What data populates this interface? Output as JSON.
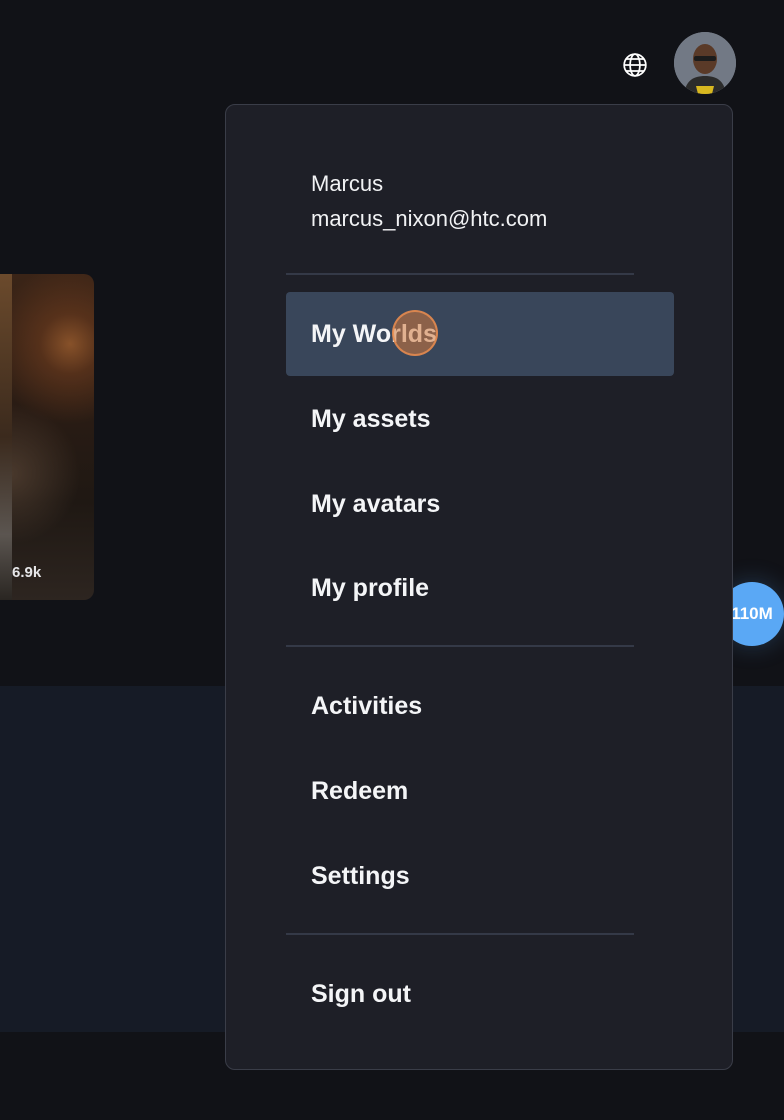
{
  "header": {
    "globe_icon": "globe-icon",
    "avatar_icon": "user-avatar"
  },
  "background": {
    "world_card": {
      "visits": "6.9k"
    },
    "badge_count": "110M",
    "badge_color": "#5aa8f5"
  },
  "menu": {
    "user": {
      "name": "Marcus",
      "email": "marcus_nixon@htc.com"
    },
    "items": [
      {
        "label": "My Worlds",
        "active": true
      },
      {
        "label": "My assets"
      },
      {
        "label": "My avatars"
      },
      {
        "label": "My profile"
      },
      {
        "label": "Activities"
      },
      {
        "label": "Redeem"
      },
      {
        "label": "Settings"
      },
      {
        "label": "Sign out"
      }
    ],
    "active_color": "#39465a",
    "background_color": "#1e1f27"
  }
}
